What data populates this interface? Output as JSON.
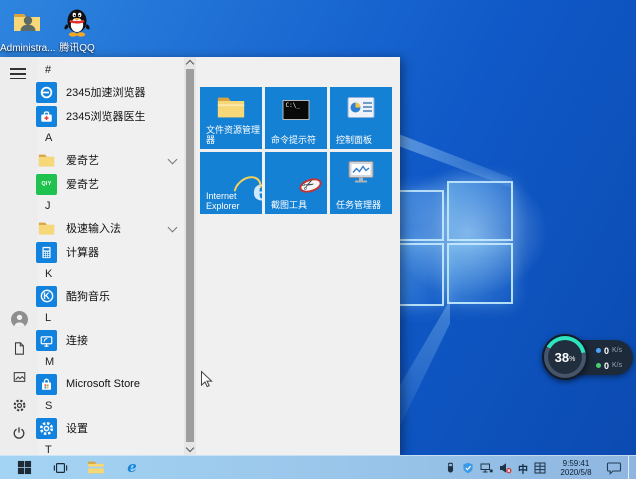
{
  "desktop": {
    "icons": [
      {
        "label": "Administra...",
        "icon": "admin-folder-icon"
      },
      {
        "label": "腾讯QQ",
        "icon": "qq-penguin-icon"
      }
    ]
  },
  "start_menu": {
    "rail_icons": [
      "hamburger-icon",
      "user-avatar-icon",
      "document-icon",
      "pictures-icon",
      "settings-gear-icon",
      "power-icon"
    ],
    "rows": [
      {
        "type": "header",
        "text": "#"
      },
      {
        "type": "app",
        "label": "2345加速浏览器",
        "icon": "browser-2345-icon"
      },
      {
        "type": "app",
        "label": "2345浏览器医生",
        "icon": "doctor-2345-icon"
      },
      {
        "type": "header",
        "text": "A"
      },
      {
        "type": "app",
        "label": "爱奇艺",
        "icon": "folder-icon",
        "expandable": true
      },
      {
        "type": "app",
        "label": "爱奇艺",
        "icon": "iqiyi-icon"
      },
      {
        "type": "header",
        "text": "J"
      },
      {
        "type": "app",
        "label": "极速输入法",
        "icon": "folder-icon",
        "expandable": true
      },
      {
        "type": "app",
        "label": "计算器",
        "icon": "calculator-icon"
      },
      {
        "type": "header",
        "text": "K"
      },
      {
        "type": "app",
        "label": "酷狗音乐",
        "icon": "kugou-icon"
      },
      {
        "type": "header",
        "text": "L"
      },
      {
        "type": "app",
        "label": "连接",
        "icon": "connect-icon"
      },
      {
        "type": "header",
        "text": "M"
      },
      {
        "type": "app",
        "label": "Microsoft Store",
        "icon": "ms-store-icon"
      },
      {
        "type": "header",
        "text": "S"
      },
      {
        "type": "app",
        "label": "设置",
        "icon": "settings-gear-icon"
      },
      {
        "type": "header",
        "text": "T"
      }
    ],
    "iqiyi_icon_letters": "QIY",
    "kugou_icon_letter": "K",
    "tiles": [
      {
        "label": "文件资源管理器",
        "icon": "file-explorer-icon"
      },
      {
        "label": "命令提示符",
        "icon": "command-prompt-icon",
        "icon_text": "C:\\_"
      },
      {
        "label": "控制面板",
        "icon": "control-panel-icon"
      },
      {
        "label": "Internet Explorer",
        "icon": "internet-explorer-icon",
        "icon_letter": "e"
      },
      {
        "label": "截图工具",
        "icon": "snipping-tool-icon",
        "icon_glyph": "✂"
      },
      {
        "label": "任务管理器",
        "icon": "task-manager-icon"
      }
    ]
  },
  "speed_widget": {
    "percent_value": "38",
    "percent_unit": "%",
    "arc_color": "#2de6c0",
    "rows": [
      {
        "value": "0",
        "unit": "K/s",
        "dot_color": "#4aa3ff"
      },
      {
        "value": "0",
        "unit": "K/s",
        "dot_color": "#49d06e"
      }
    ]
  },
  "taskbar": {
    "buttons": [
      "start",
      "task-view",
      "file-explorer",
      "internet-explorer"
    ],
    "ie_letter": "e",
    "tray": {
      "icons": [
        "usb-icon",
        "security-shield-icon",
        "network-monitor-icon",
        "volume-muted-icon",
        "ime-chinese-indicator",
        "ime-layout-icon"
      ],
      "ime_indicator": "中",
      "clock_time": "9:59:41",
      "clock_date": "2020/5/8"
    }
  },
  "colors": {
    "tile_blue": "#1581d4",
    "app_icon_blue": "#1182dd",
    "menu_bg": "#f0f0f0",
    "taskbar_blue": "#a4d4f3",
    "wallpaper_blue": "#1059c8",
    "widget_bg": "#1d2a39",
    "widget_arc": "#2de6c0"
  }
}
